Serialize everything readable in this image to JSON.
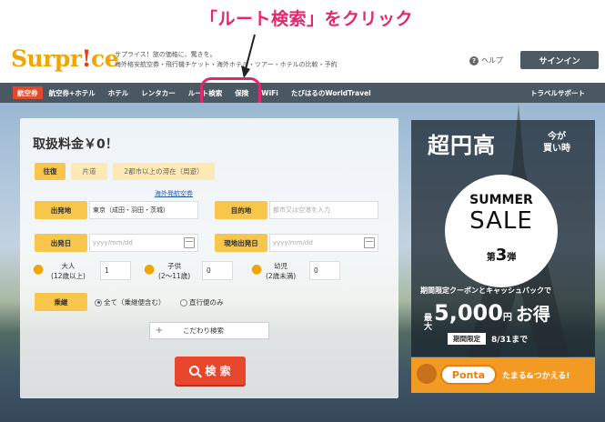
{
  "annotation": {
    "text": "「ルート検索」をクリック"
  },
  "header": {
    "logo_main": "Surpr",
    "logo_bang": "!",
    "logo_tail": "ce",
    "tagline_1": "サプライス！旅の価格に、驚きを。",
    "tagline_2": "海外格安航空券・飛行機チケット・海外ホテル・ツアー・ホテルの比較・予約",
    "help_label": "ヘルプ",
    "signin_label": "サインイン"
  },
  "nav": {
    "items": [
      "航空券",
      "航空券+ホテル",
      "ホテル",
      "レンタカー",
      "ルート検索",
      "保険",
      "WiFi",
      "たびはるのWorldTravel"
    ],
    "right": "トラベルサポート"
  },
  "search": {
    "fee": "取扱料金￥0！",
    "trip_types": [
      "往復",
      "片道",
      "2都市以上の滞在（周遊）"
    ],
    "overseas_link": "海外発航空券",
    "origin_label": "出発地",
    "origin_value": "東京（成田・羽田・茨城）",
    "dest_label": "目的地",
    "dest_placeholder": "都市又は空港を入力",
    "depart_label": "出発日",
    "depart_placeholder": "yyyy/mm/dd",
    "return_label": "現地出発日",
    "return_placeholder": "yyyy/mm/dd",
    "adult_label_1": "大人",
    "adult_label_2": "(12歳以上)",
    "adult_value": "1",
    "child_label_1": "子供",
    "child_label_2": "(2〜11歳)",
    "child_value": "0",
    "infant_label_1": "幼児",
    "infant_label_2": "(2歳未満)",
    "infant_value": "0",
    "transfer_label": "乗継",
    "transfer_options": [
      "全て（乗継便含む）",
      "直行便のみ"
    ],
    "pref_label": "こだわり検索",
    "search_label": "検 索"
  },
  "promo": {
    "title": "超円高",
    "sub_1": "今が",
    "sub_2": "買い時",
    "summer": "SUMMER",
    "sale": "SALE",
    "wave_pre": "第",
    "wave_num": "3",
    "wave_post": "弾",
    "coupon": "期間限定クーポンとキャッシュバックで",
    "max_label": "最大",
    "amount": "5,000",
    "yen": "円",
    "deal": "お得",
    "limited": "期間限定",
    "until": "8/31まで"
  },
  "ponta": {
    "badge": "Ponta",
    "text": "たまる&つかえる!"
  },
  "colors": {
    "accent": "#e6256c",
    "nav_bg": "#4a5864",
    "label_yellow": "#f7c64a",
    "search_red": "#e9472d",
    "ponta_orange": "#f39a23"
  }
}
